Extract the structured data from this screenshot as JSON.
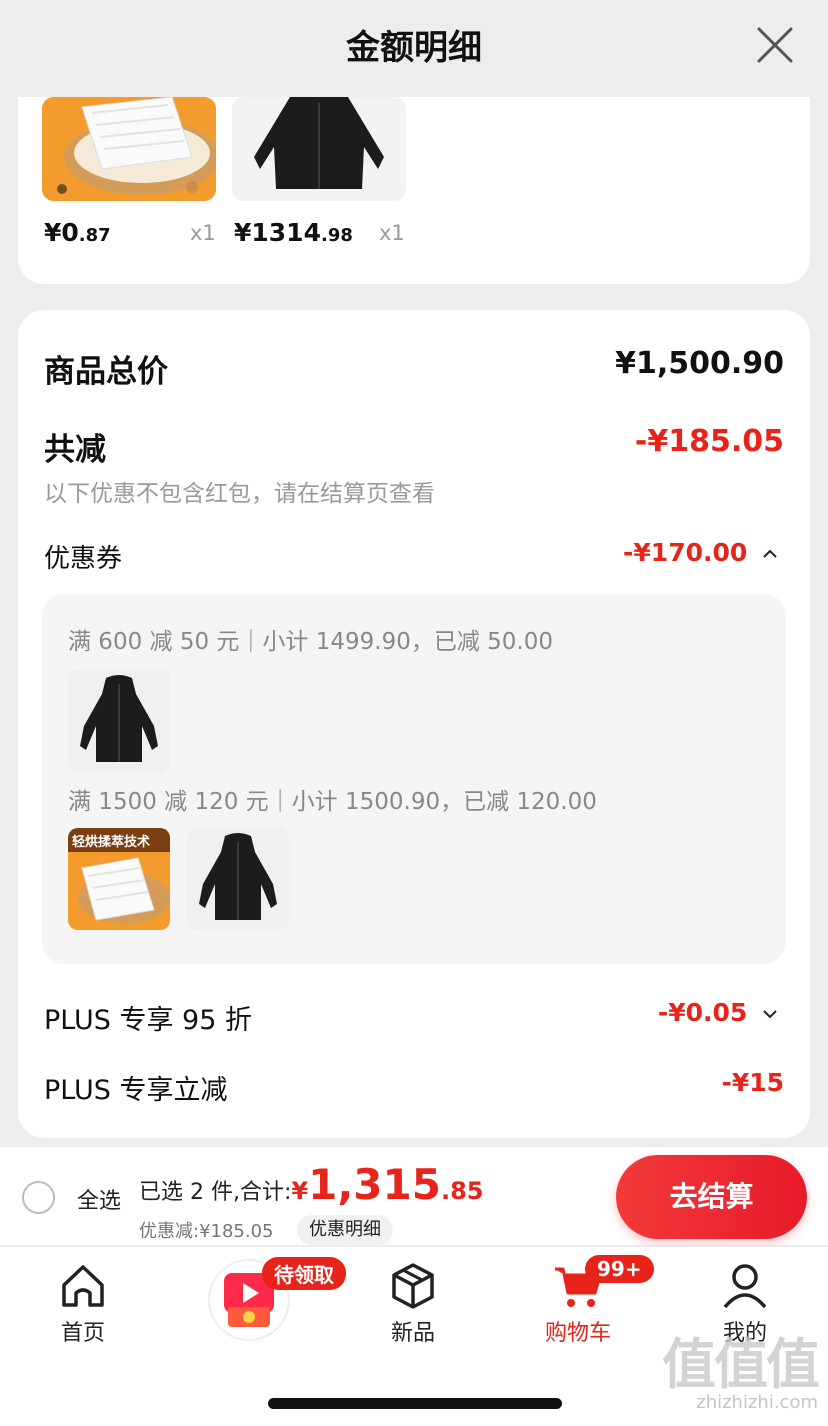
{
  "header": {
    "title": "金额明细"
  },
  "top_items": [
    {
      "price_main": "¥0",
      "price_cents": ".87",
      "qty": "x1"
    },
    {
      "price_main": "¥1314",
      "price_cents": ".98",
      "qty": "x1"
    }
  ],
  "detail": {
    "goods_total_label": "商品总价",
    "goods_total_value": "¥1,500.90",
    "total_off_label": "共减",
    "total_off_value": "-¥185.05",
    "note": "以下优惠不包含红包，请在结算页查看",
    "coupon_label": "优惠券",
    "coupon_value": "-¥170.00",
    "coupon_rules": [
      {
        "text": "满 600 减 50 元｜小计 1499.90，已减 50.00"
      },
      {
        "text": "满 1500 减 120 元｜小计 1500.90，已减 120.00"
      }
    ],
    "product_badge": "轻烘揉萃技术",
    "plus_discount_label": "PLUS 专享 95 折",
    "plus_discount_value": "-¥0.05",
    "plus_instant_label": "PLUS 专享立减",
    "plus_instant_value": "-¥15"
  },
  "checkout": {
    "select_all": "全选",
    "selected_text": "已选 2 件,合计:",
    "total_yen": "¥",
    "total_big": "1,315",
    "total_cents": ".85",
    "discount_line": "优惠减:¥185.05",
    "discount_detail_chip": "优惠明细",
    "checkout_button": "去结算"
  },
  "tabbar": {
    "home": "首页",
    "promo_badge": "待领取",
    "new": "新品",
    "cart": "购物车",
    "cart_badge": "99+",
    "mine": "我的"
  },
  "watermark": {
    "logo": "值值值",
    "url": "zhizhizhi.com"
  },
  "colors": {
    "accent": "#e8231a",
    "background": "#ededed",
    "panel": "#f5f5f5"
  }
}
